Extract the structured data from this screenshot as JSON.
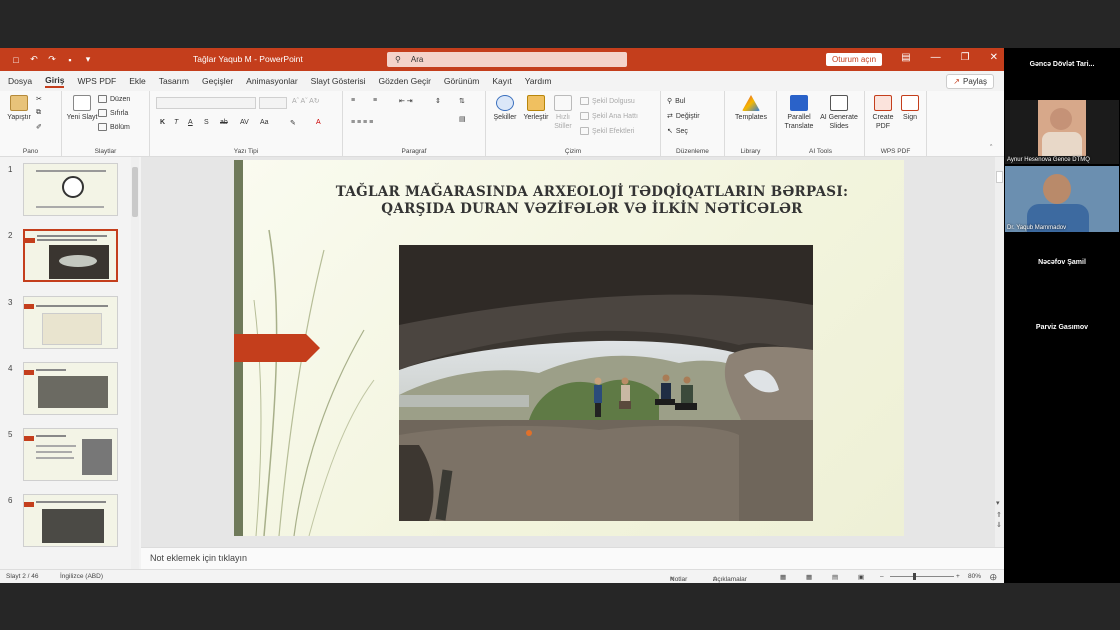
{
  "window": {
    "title": "Tağlar Yaqub M  -  PowerPoint",
    "search_placeholder": "Ara",
    "signin_label": "Oturum açın"
  },
  "menu": {
    "tabs": [
      "Dosya",
      "Giriş",
      "WPS PDF",
      "Ekle",
      "Tasarım",
      "Geçişler",
      "Animasyonlar",
      "Slayt Gösterisi",
      "Gözden Geçir",
      "Görünüm",
      "Kayıt",
      "Yardım"
    ],
    "active_tab": "Giriş",
    "share_label": "Paylaş"
  },
  "ribbon": {
    "pano": {
      "label": "Pano",
      "paste": "Yapıştır"
    },
    "slaytlar": {
      "label": "Slaytlar",
      "new_slide": "Yeni Slayt",
      "layout": "Düzen",
      "reset": "Sıfırla",
      "section": "Bölüm"
    },
    "yazi_tipi": {
      "label": "Yazı Tipi"
    },
    "paragraf": {
      "label": "Paragraf"
    },
    "cizim": {
      "label": "Çizim",
      "shapes": "Şekiller",
      "arrange": "Yerleştir",
      "quick_styles": "Hızlı Stiller",
      "fill": "Şekil Dolgusu",
      "outline": "Şekil Ana Hattı",
      "effects": "Şekil Efektleri"
    },
    "duzenleme": {
      "label": "Düzenleme",
      "find": "Bul",
      "replace": "Değiştir",
      "select": "Seç"
    },
    "library": {
      "label": "Library",
      "templates": "Templates"
    },
    "ai_tools": {
      "label": "AI Tools",
      "parallel_translate": "Parallel Translate",
      "ai_generate": "AI Generate Slides"
    },
    "wps_pdf": {
      "label": "WPS PDF",
      "create_pdf": "Create PDF",
      "sign": "Sign"
    }
  },
  "thumbnails": [
    {
      "number": "1"
    },
    {
      "number": "2"
    },
    {
      "number": "3"
    },
    {
      "number": "4"
    },
    {
      "number": "5"
    },
    {
      "number": "6"
    }
  ],
  "active_slide_index": 2,
  "slide": {
    "title_line1": "TAĞLAR MAĞARASINDA ARXEOLOJİ TƏDQİQATLARIN BƏRPASI:",
    "title_line2": "QARŞIDA DURAN VƏZİFƏLƏR VƏ İLKİN NƏTİCƏLƏR"
  },
  "notes_placeholder": "Not eklemek için tıklayın",
  "status": {
    "slide_counter": "Slayt 2 / 46",
    "language": "İngilizce (ABD)",
    "notes": "Notlar",
    "comments": "Açıklamalar",
    "zoom": "80%"
  },
  "participants": {
    "header": "Gəncə Dövlət Tari...",
    "p1": "Aynur Hesenova Gence DTMQ",
    "p2": "Dr. Yaqub Mammadov",
    "p3": "Nəcəfov Şamil",
    "p4": "Parviz Gasımov"
  },
  "colors": {
    "accent": "#c43e1c",
    "slide_bg": "#f2f4dd"
  }
}
